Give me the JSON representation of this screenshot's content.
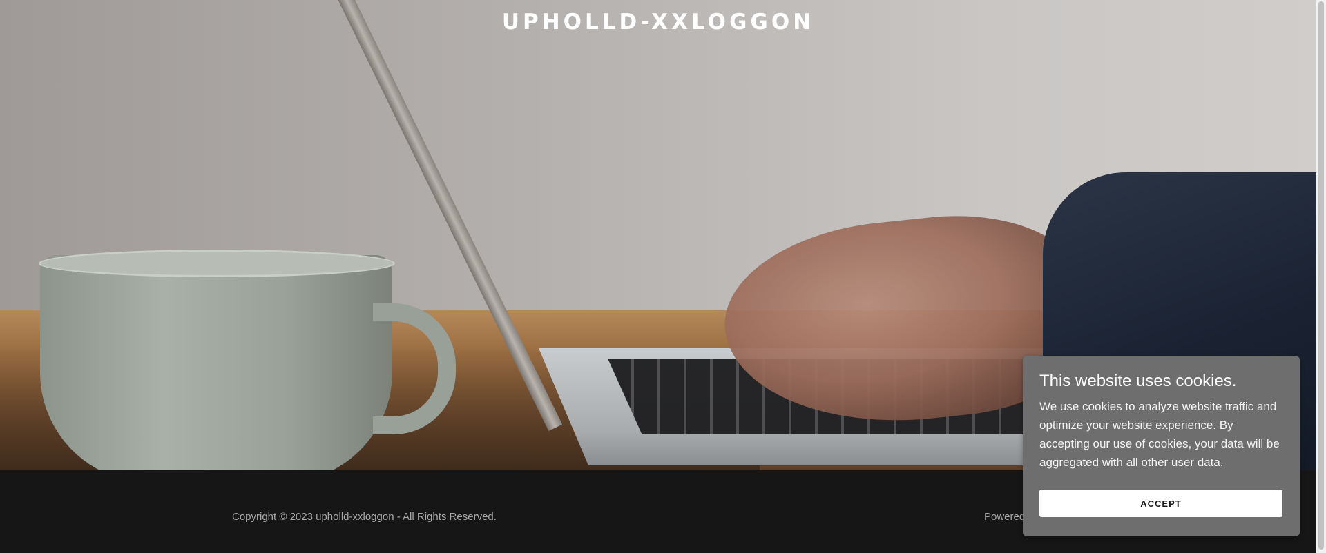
{
  "header": {
    "site_title": "UPHOLLD-XXLOGGON"
  },
  "hero": {
    "image": "laptop-typing-coffee-cup-photo"
  },
  "footer": {
    "copyright": "Copyright © 2023 upholld-xxloggon - All Rights Reserved.",
    "powered_by": "Powered"
  },
  "cookie_banner": {
    "title": "This website uses cookies.",
    "body": "We use cookies to analyze website traffic and optimize your website experience. By accepting our use of cookies, your data will be aggregated with all other user data.",
    "accept_label": "ACCEPT"
  },
  "colors": {
    "footer_bg": "#161616",
    "cookie_bg": "#6e6e6e",
    "button_bg": "#ffffff",
    "title_text": "#ffffff"
  }
}
